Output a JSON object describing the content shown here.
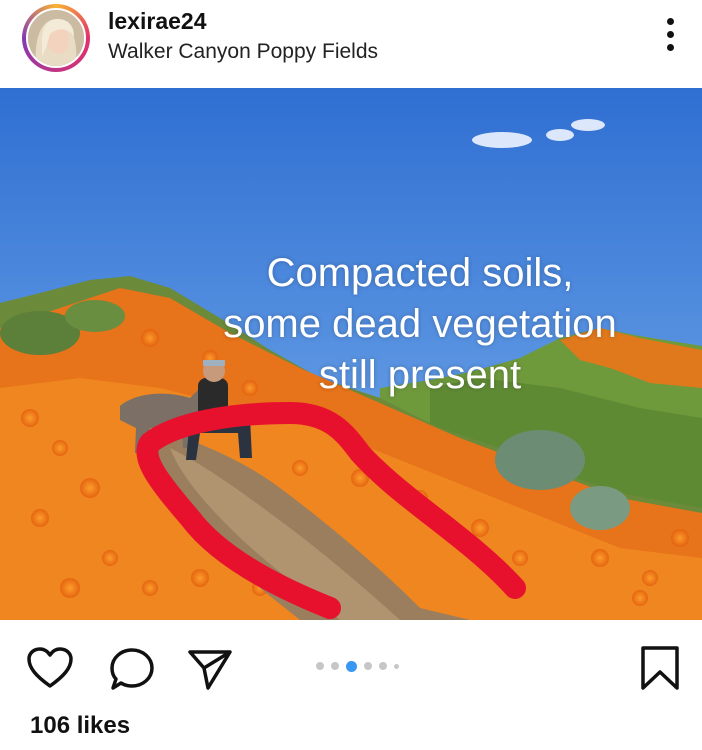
{
  "post": {
    "username": "lexirae24",
    "location": "Walker Canyon Poppy Fields",
    "overlay_text": [
      "Compacted soils,",
      "some dead vegetation",
      "still present"
    ],
    "likes": "106 likes"
  },
  "carousel": {
    "total": 6,
    "active_index": 2
  },
  "icons": {
    "more": "more-options-icon",
    "like": "heart-icon",
    "comment": "comment-icon",
    "share": "share-icon",
    "save": "bookmark-icon"
  },
  "colors": {
    "carousel_active": "#3897f0",
    "annotation": "#e8112d",
    "poppy": "#f07a1a"
  }
}
